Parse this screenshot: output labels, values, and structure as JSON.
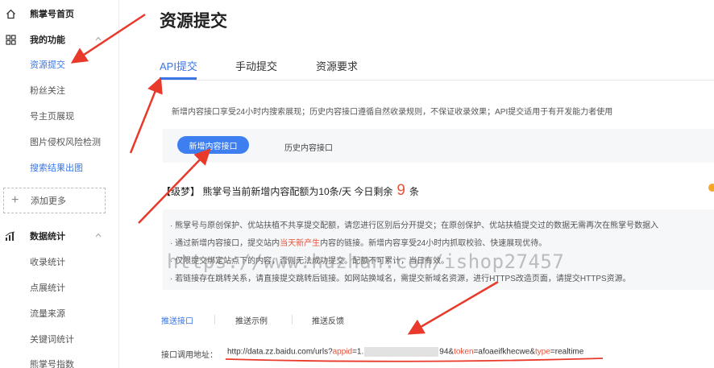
{
  "sidebar": {
    "home_label": "熊掌号首页",
    "my_functions_label": "我的功能",
    "items": [
      {
        "label": "资源提交"
      },
      {
        "label": "粉丝关注"
      },
      {
        "label": "号主页展现"
      },
      {
        "label": "图片侵权风险检测"
      },
      {
        "label": "搜索结果出图"
      }
    ],
    "add_more_label": "添加更多",
    "data_stats_label": "数据统计",
    "data_items": [
      {
        "label": "收录统计"
      },
      {
        "label": "点展统计"
      },
      {
        "label": "流量来源"
      },
      {
        "label": "关键词统计"
      },
      {
        "label": "熊掌号指数"
      }
    ]
  },
  "main": {
    "title": "资源提交",
    "tabs": [
      {
        "label": "API提交"
      },
      {
        "label": "手动提交"
      },
      {
        "label": "资源要求"
      }
    ],
    "notice": "新增内容接口享受24小时内搜索展现；历史内容接口遵循自然收录规则，不保证收录效果；API提交适用于有开发能力者使用",
    "subtabs": [
      {
        "label": "新增内容接口"
      },
      {
        "label": "历史内容接口"
      }
    ],
    "quota": {
      "prefix": "【级梦】 熊掌号当前新增内容配额为10条/天 今日剩余",
      "remaining": "9",
      "unit": "条"
    },
    "info_lines": {
      "line1": "熊掌号与原创保护、优站扶植不共享提交配额，请您进行区别后分开提交；在原创保护、优站扶植提交过的数据无需再次在熊掌号数据入",
      "line2_a": "通过新增内容接口，提交站内",
      "line2_hl": "当天新产生",
      "line2_b": "内容的链接。新增内容享受24小时内抓取校验、快速展现优待。",
      "line3": "仅限提交绑定站点下的内容，否则无法成功提交。配额不可累计，当日有效。",
      "line4": "若链接存在跳转关系，请直接提交跳转后链接。如网站换域名，需提交新域名资源，进行HTTPS改造页面，请提交HTTPS资源。"
    },
    "watermark": "https://www.huzhan.com/ishop27457",
    "subnav": [
      {
        "label": "推送接口"
      },
      {
        "label": "推送示例"
      },
      {
        "label": "推送反馈"
      }
    ],
    "api": {
      "label": "接口调用地址：",
      "url_a": "http://data.zz.baidu.com/urls?",
      "appid_key": "appid",
      "url_b": "=1.",
      "url_c": "94&",
      "token_key": "token",
      "url_d": "=afoaeifkhecwe&",
      "type_key": "type",
      "url_e": "=realtime"
    }
  },
  "colors": {
    "accent": "#3876e6",
    "highlight": "#e8533c",
    "annotation_arrow": "#e8392b"
  }
}
